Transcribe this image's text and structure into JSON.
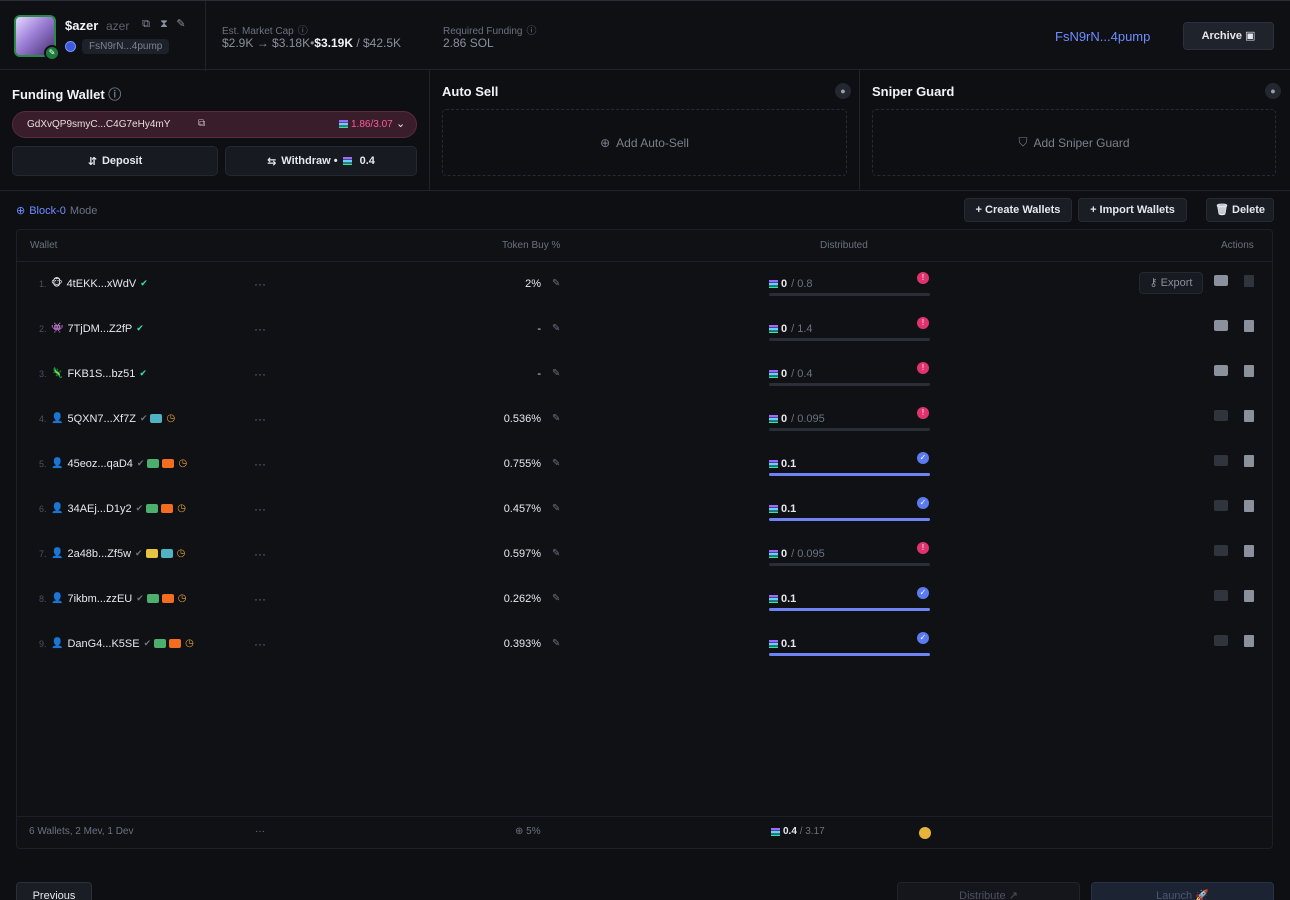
{
  "header": {
    "token_name": "$azer",
    "token_symbol": "azer",
    "token_address": "FsN9rN...4pump",
    "market_cap_label": "Est. Market Cap",
    "market_cap_from": "$2.9K",
    "market_cap_arrow": "→",
    "market_cap_mid": "$3.18K",
    "market_cap_bold": "$3.19K",
    "market_cap_total": "/ $42.5K",
    "funding_label": "Required Funding",
    "funding_value": "2.86 SOL",
    "contract_link": "FsN9rN...4pump",
    "archive_label": "Archive"
  },
  "funding_wallet": {
    "title": "Funding Wallet",
    "address": "GdXvQP9smyC...C4G7eHy4mY",
    "balance": "1.86/3.07",
    "deposit_label": "Deposit",
    "withdraw_label": "Withdraw •",
    "withdraw_amount": "0.4"
  },
  "auto_sell": {
    "title": "Auto Sell",
    "add_label": "Add Auto-Sell"
  },
  "sniper_guard": {
    "title": "Sniper Guard",
    "add_label": "Add Sniper Guard"
  },
  "toolbar": {
    "mode_highlight": "Block-0",
    "mode_suffix": "Mode",
    "create_label": "+ Create Wallets",
    "import_label": "+ Import Wallets",
    "delete_label": "Delete"
  },
  "table": {
    "col_wallet": "Wallet",
    "col_buy": "Token Buy %",
    "col_dist": "Distributed",
    "col_actions": "Actions",
    "export_label": "Export",
    "rows": [
      {
        "idx": "1.",
        "name": "4tEKK...xWdV",
        "icon": "🐵",
        "pct": "2%",
        "dist": "0",
        "total": "/ 0.8",
        "status": "bad",
        "tags": [],
        "clock": false,
        "verified": true,
        "export": true,
        "fill": 0
      },
      {
        "idx": "2.",
        "name": "7TjDM...Z2fP",
        "icon": "👾",
        "pct": "-",
        "dist": "0",
        "total": "/ 1.4",
        "status": "bad",
        "tags": [],
        "clock": false,
        "verified": true,
        "export": false,
        "fill": 0
      },
      {
        "idx": "3.",
        "name": "FKB1S...bz51",
        "icon": "🦎",
        "pct": "-",
        "dist": "0",
        "total": "/ 0.4",
        "status": "bad",
        "tags": [],
        "clock": false,
        "verified": true,
        "export": false,
        "fill": 0
      },
      {
        "idx": "4.",
        "name": "5QXN7...Xf7Z",
        "icon": "👤",
        "pct": "0.536%",
        "dist": "0",
        "total": "/ 0.095",
        "status": "bad",
        "tags": [
          "teal"
        ],
        "clock": true,
        "verified": false,
        "export": false,
        "fill": 0
      },
      {
        "idx": "5.",
        "name": "45eoz...qaD4",
        "icon": "👤",
        "pct": "0.755%",
        "dist": "0.1",
        "total": "",
        "status": "ok",
        "tags": [
          "green",
          "orange"
        ],
        "clock": true,
        "verified": false,
        "export": false,
        "fill": 1
      },
      {
        "idx": "6.",
        "name": "34AEj...D1y2",
        "icon": "👤",
        "pct": "0.457%",
        "dist": "0.1",
        "total": "",
        "status": "ok",
        "tags": [
          "green",
          "orange"
        ],
        "clock": true,
        "verified": false,
        "export": false,
        "fill": 1
      },
      {
        "idx": "7.",
        "name": "2a48b...Zf5w",
        "icon": "👤",
        "pct": "0.597%",
        "dist": "0",
        "total": "/ 0.095",
        "status": "bad",
        "tags": [
          "yellow",
          "teal"
        ],
        "clock": true,
        "verified": false,
        "export": false,
        "fill": 0
      },
      {
        "idx": "8.",
        "name": "7ikbm...zzEU",
        "icon": "👤",
        "pct": "0.262%",
        "dist": "0.1",
        "total": "",
        "status": "ok",
        "tags": [
          "green",
          "orange"
        ],
        "clock": true,
        "verified": false,
        "export": false,
        "fill": 1
      },
      {
        "idx": "9.",
        "name": "DanG4...K5SE",
        "icon": "👤",
        "pct": "0.393%",
        "dist": "0.1",
        "total": "",
        "status": "ok",
        "tags": [
          "green",
          "orange"
        ],
        "clock": true,
        "verified": false,
        "export": false,
        "fill": 1
      }
    ],
    "footer_summary": "6 Wallets, 2 Mev, 1 Dev",
    "footer_dots": "···",
    "footer_pct": "5%",
    "footer_dist": "0.4",
    "footer_total": "/ 3.17"
  },
  "bottom": {
    "left_label": "Previous",
    "mid_label": "Distribute",
    "right_label": "Launch"
  },
  "colors": {
    "accent": "#6f8cff",
    "danger": "#e0336d",
    "ok": "#5b7cf0",
    "warn": "#e8a33a"
  }
}
